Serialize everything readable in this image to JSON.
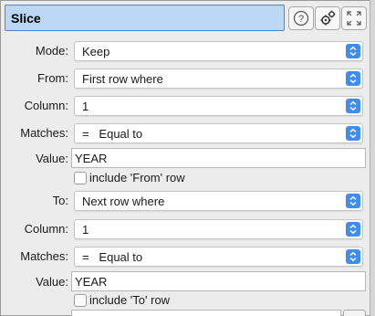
{
  "panel": {
    "title": "Slice",
    "buttons": {
      "help_icon": "help-circle-icon",
      "settings_icon": "gears-icon",
      "expand_icon": "expand-arrows-icon"
    }
  },
  "form": {
    "mode": {
      "label": "Mode:",
      "value": "Keep"
    },
    "from": {
      "label": "From:",
      "value": "First row where"
    },
    "from_column": {
      "label": "Column:",
      "value": "1"
    },
    "from_matches": {
      "label": "Matches:",
      "value": "=   Equal to"
    },
    "from_value": {
      "label": "Value:",
      "value": "YEAR"
    },
    "include_from": {
      "label": "include 'From' row",
      "checked": false
    },
    "to": {
      "label": "To:",
      "value": "Next row where"
    },
    "to_column": {
      "label": "Column:",
      "value": "1"
    },
    "to_matches": {
      "label": "Matches:",
      "value": "=   Equal to"
    },
    "to_value": {
      "label": "Value:",
      "value": "YEAR"
    },
    "include_to": {
      "label": "include 'To' row",
      "checked": false
    }
  },
  "colors": {
    "title_bg": "#bcd7f3",
    "title_border": "#4f86c6",
    "select_arrow": "#3f8cf2"
  }
}
